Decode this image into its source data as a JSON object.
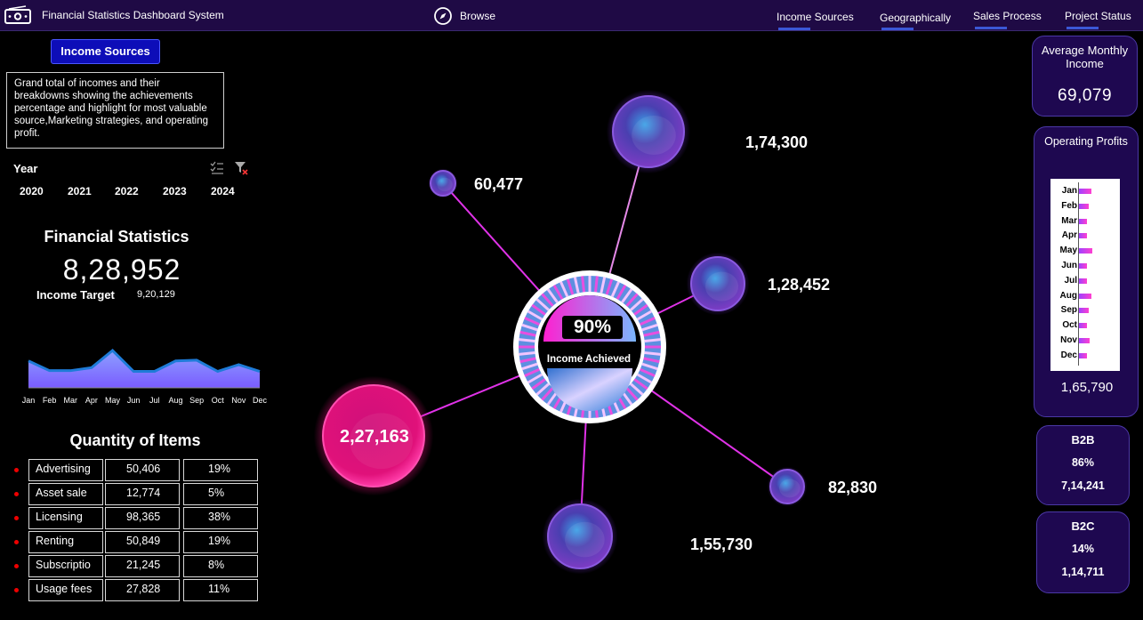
{
  "app": {
    "title": "Financial Statistics Dashboard System",
    "browse": "Browse"
  },
  "nav": {
    "tabs": [
      "Income Sources",
      "Geographically",
      "Sales Process",
      "Project Status"
    ]
  },
  "left": {
    "chip": "Income Sources",
    "description": "Grand total of incomes and their breakdowns showing the achievements percentage and highlight for most valuable source,Marketing strategies, and operating profit.",
    "year_label": "Year",
    "years": [
      "2020",
      "2021",
      "2022",
      "2023",
      "2024"
    ],
    "fs_title": "Financial Statistics",
    "fs_value": "8,28,952",
    "target_label": "Income Target",
    "target_value": "9,20,129",
    "qty_title": "Quantity of Items"
  },
  "chart_data": {
    "type": "area",
    "categories": [
      "Jan",
      "Feb",
      "Mar",
      "Apr",
      "May",
      "Jun",
      "Jul",
      "Aug",
      "Sep",
      "Oct",
      "Nov",
      "Dec"
    ],
    "values": [
      72,
      46,
      46,
      54,
      100,
      44,
      44,
      72,
      74,
      44,
      62,
      44
    ],
    "title": "",
    "xlabel": "",
    "ylabel": "",
    "grid": false
  },
  "items": [
    {
      "name": "Advertising",
      "qty": "50,406",
      "pct": "19%"
    },
    {
      "name": "Asset sale",
      "qty": "12,774",
      "pct": "5%"
    },
    {
      "name": "Licensing",
      "qty": "98,365",
      "pct": "38%"
    },
    {
      "name": "Renting",
      "qty": "50,849",
      "pct": "19%"
    },
    {
      "name": "Subscriptio",
      "qty": "21,245",
      "pct": "8%"
    },
    {
      "name": "Usage fees",
      "qty": "27,828",
      "pct": "11%"
    }
  ],
  "center": {
    "percent": "90%",
    "label": "Income Achieved",
    "bubbles": [
      "60,477",
      "1,74,300",
      "1,28,452",
      "2,27,163",
      "82,830",
      "1,55,730"
    ]
  },
  "right": {
    "avg_title": "Average Monthly Income",
    "avg_value": "69,079",
    "op_title": "Operating Profits",
    "op_months": [
      "Jan",
      "Feb",
      "Mar",
      "Apr",
      "May",
      "Jun",
      "Jul",
      "Aug",
      "Sep",
      "Oct",
      "Nov",
      "Dec"
    ],
    "op_levels": [
      0.45,
      0.35,
      0.3,
      0.3,
      0.5,
      0.3,
      0.3,
      0.45,
      0.35,
      0.3,
      0.4,
      0.3
    ],
    "op_value": "1,65,790",
    "b2b": {
      "title": "B2B",
      "pct": "86%",
      "amount": "7,14,241"
    },
    "b2c": {
      "title": "B2C",
      "pct": "14%",
      "amount": "1,14,711"
    }
  },
  "colors": {
    "accent": "#3b57d6",
    "bubble_highlight": "#e0117a",
    "line": "#e032e8"
  },
  "icons": [
    "cash-icon",
    "compass-icon",
    "multi-select-icon",
    "clear-filter-icon"
  ]
}
